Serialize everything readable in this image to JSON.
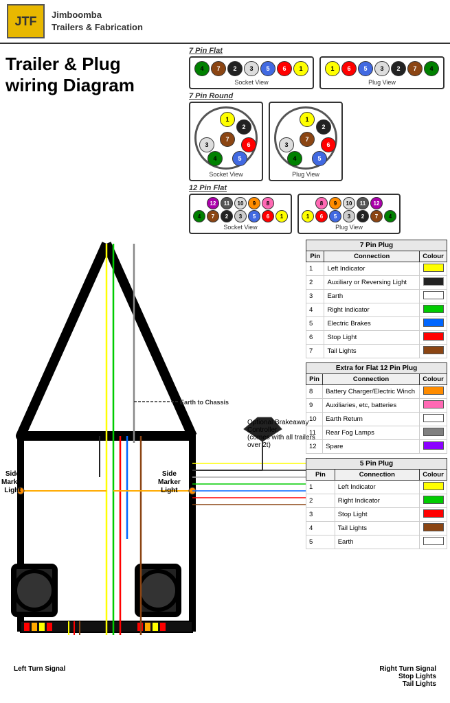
{
  "header": {
    "logo_text": "JTF",
    "company_name": "Jimboomba\nTrailers & Fabrication",
    "main_title": "Trailer & Plug\nwiring Diagram"
  },
  "diagrams": {
    "flat7_label": "7 Pin Flat",
    "round7_label": "7 Pin Round",
    "flat12_label": "12 Pin Flat",
    "socket_view": "Socket View",
    "plug_view": "Plug View"
  },
  "brakeaway": {
    "label": "Optional Brakeaway Controller\n(comes with all trailers over 2t)"
  },
  "earth_label": "Earth to Chassis",
  "side_marker": "Side\nMarker\nLight",
  "bottom_labels": {
    "left": "Left Turn Signal",
    "right1": "Right Turn Signal",
    "right2": "Stop Lights",
    "right3": "Tail Lights"
  },
  "table_7pin": {
    "title": "7 Pin Plug",
    "headers": [
      "Pin",
      "Connection",
      "Colour"
    ],
    "rows": [
      {
        "pin": "1",
        "connection": "Left Indicator",
        "colour": "Yellow",
        "hex": "#FFFF00"
      },
      {
        "pin": "2",
        "connection": "Auxiliary or Reversing Light",
        "colour": "Black",
        "hex": "#000000"
      },
      {
        "pin": "3",
        "connection": "Earth",
        "colour": "White",
        "hex": "#FFFFFF"
      },
      {
        "pin": "4",
        "connection": "Right Indicator",
        "colour": "Green",
        "hex": "#00CC00"
      },
      {
        "pin": "5",
        "connection": "Electric Brakes",
        "colour": "Blue",
        "hex": "#0000FF"
      },
      {
        "pin": "6",
        "connection": "Stop Light",
        "colour": "Red",
        "hex": "#FF0000"
      },
      {
        "pin": "7",
        "connection": "Tail Lights",
        "colour": "Brown",
        "hex": "#8B4513"
      }
    ]
  },
  "table_12pin": {
    "title": "Extra for Flat 12 Pin Plug",
    "headers": [
      "Pin",
      "Connection",
      "Colour"
    ],
    "rows": [
      {
        "pin": "8",
        "connection": "Battery Charger/Electric Winch",
        "colour": "Orange",
        "hex": "#FF8C00"
      },
      {
        "pin": "9",
        "connection": "Auxiliaries, etc, batteries",
        "colour": "Pink",
        "hex": "#FF69B4"
      },
      {
        "pin": "10",
        "connection": "Earth Return",
        "colour": "White",
        "hex": "#FFFFFF"
      },
      {
        "pin": "11",
        "connection": "Rear Fog Lamps",
        "colour": "Grey",
        "hex": "#808080"
      },
      {
        "pin": "12",
        "connection": "Spare",
        "colour": "Violet",
        "hex": "#8B00FF"
      }
    ]
  },
  "table_5pin": {
    "title": "5 Pin Plug",
    "headers": [
      "Pin",
      "Connection",
      "Colour"
    ],
    "rows": [
      {
        "pin": "1",
        "connection": "Left Indicator",
        "colour": "Yellow",
        "hex": "#FFFF00"
      },
      {
        "pin": "2",
        "connection": "Right Indicator",
        "colour": "Green",
        "hex": "#00CC00"
      },
      {
        "pin": "3",
        "connection": "Stop Light",
        "colour": "Red",
        "hex": "#FF0000"
      },
      {
        "pin": "4",
        "connection": "Tail Lights",
        "colour": "Brown",
        "hex": "#8B4513"
      },
      {
        "pin": "5",
        "connection": "Earth",
        "colour": "White",
        "hex": "#FFFFFF"
      }
    ]
  },
  "pin_colors": {
    "flat7_socket": [
      {
        "num": "4",
        "color": "#008000"
      },
      {
        "num": "7",
        "color": "#8B4513"
      },
      {
        "num": "2",
        "color": "#222222"
      },
      {
        "num": "3",
        "color": "#C0C0C0"
      },
      {
        "num": "5",
        "color": "#4169E1"
      },
      {
        "num": "6",
        "color": "#FF0000"
      },
      {
        "num": "1",
        "color": "#FFFF00"
      }
    ],
    "flat7_plug": [
      {
        "num": "1",
        "color": "#FFFF00"
      },
      {
        "num": "6",
        "color": "#FF0000"
      },
      {
        "num": "5",
        "color": "#4169E1"
      },
      {
        "num": "3",
        "color": "#C0C0C0"
      },
      {
        "num": "2",
        "color": "#222222"
      },
      {
        "num": "7",
        "color": "#8B4513"
      },
      {
        "num": "4",
        "color": "#008000"
      }
    ]
  }
}
